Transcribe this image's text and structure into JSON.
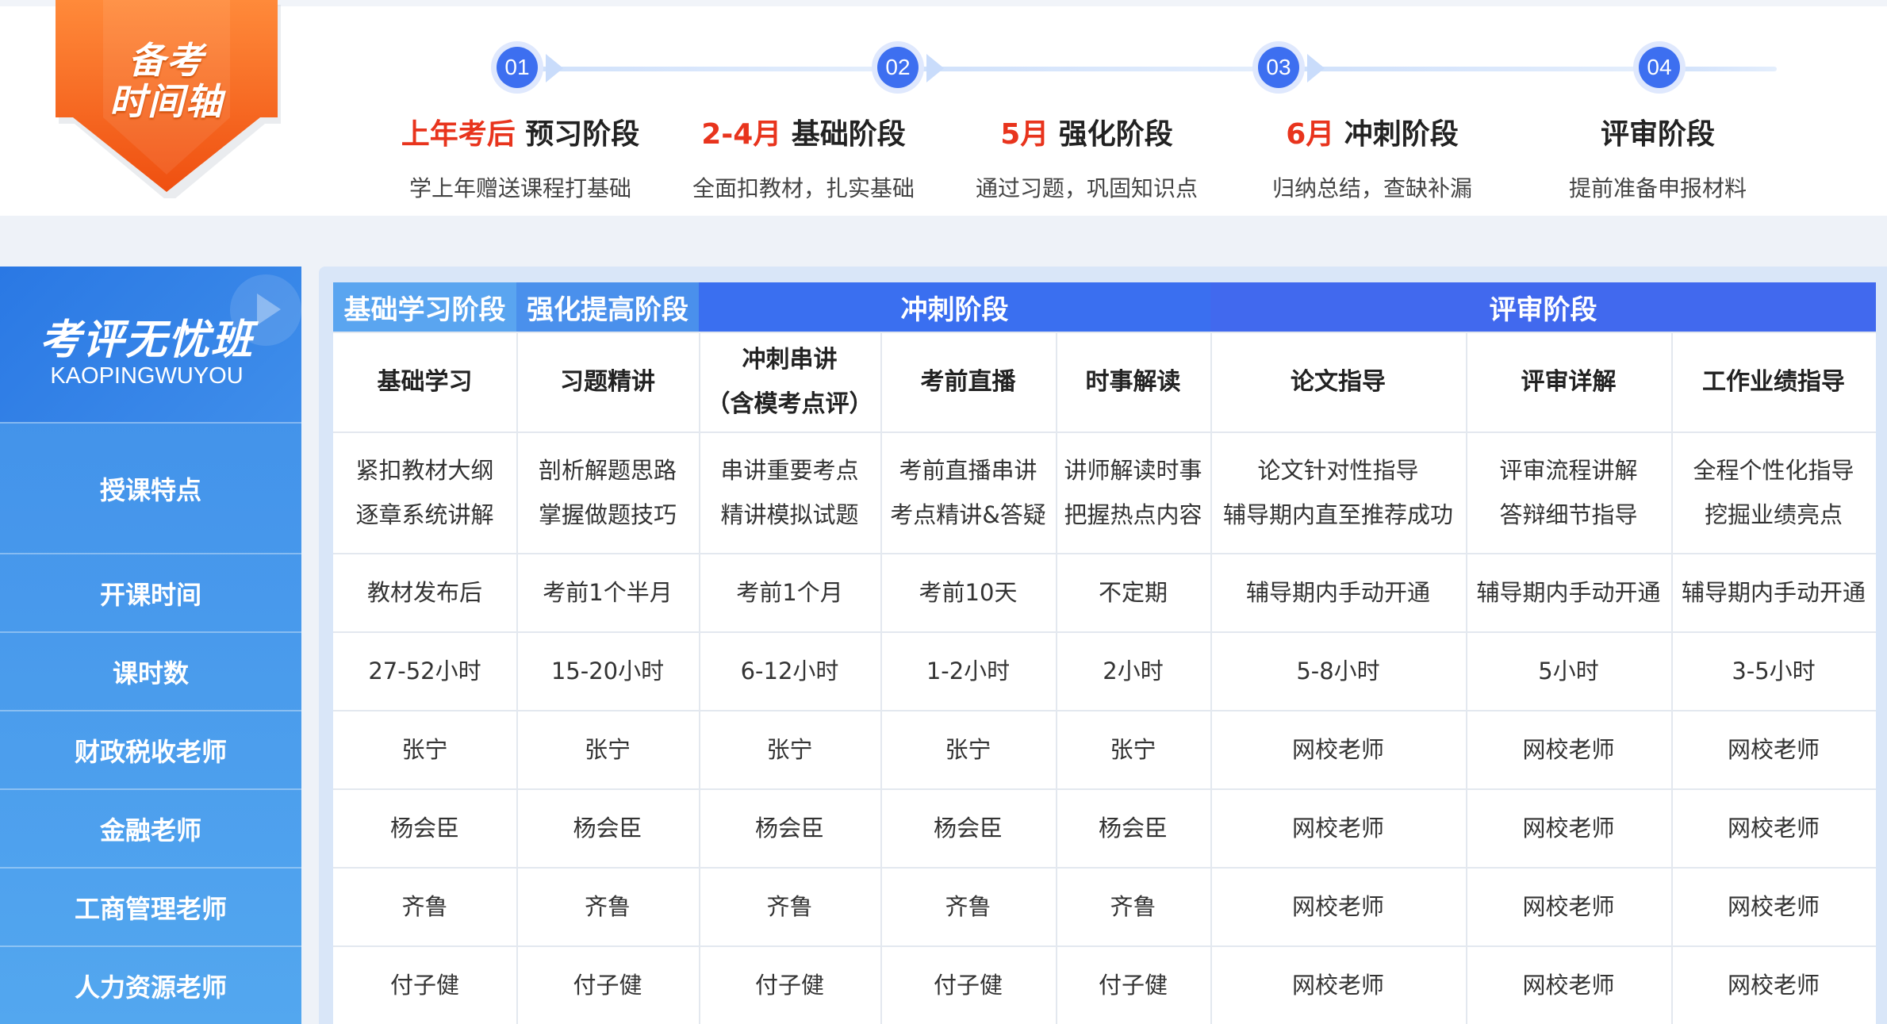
{
  "badge": {
    "line1": "备考",
    "line2": "时间轴"
  },
  "timeline": [
    {
      "num": "01",
      "highlight": "上年考后",
      "title": " 预习阶段",
      "desc": "学上年赠送课程打基础"
    },
    {
      "num": "02",
      "highlight": "2-4月",
      "title": " 基础阶段",
      "desc": "全面扣教材，扎实基础"
    },
    {
      "num": "03",
      "highlight": "5月",
      "title": " 强化阶段",
      "desc": "通过习题，巩固知识点"
    },
    {
      "num": "04",
      "highlight": "6月",
      "title": " 冲刺阶段",
      "desc": "归纳总结，查缺补漏"
    },
    {
      "num": "",
      "highlight": "",
      "title": "评审阶段",
      "desc": "提前准备申报材料"
    }
  ],
  "node_numbers": [
    "01",
    "02",
    "03",
    "04"
  ],
  "logo": {
    "name": "考评无忧班",
    "sub": "KAOPINGWUYOU"
  },
  "row_labels": [
    "授课特点",
    "开课时间",
    "课时数",
    "财政税收老师",
    "金融老师",
    "工商管理老师",
    "人力资源老师"
  ],
  "colors": {
    "phase1": "#5aa5f0",
    "phase2": "#4a90ec",
    "phase3": "#3a6ff0",
    "phase4": "#4169ee",
    "accent": "#e8341d",
    "badge": "#f3641a"
  },
  "phases": [
    "基础学习阶段",
    "强化提高阶段",
    "冲刺阶段",
    "评审阶段"
  ],
  "columns": [
    {
      "h1": "基础学习",
      "h2": ""
    },
    {
      "h1": "习题精讲",
      "h2": ""
    },
    {
      "h1": "冲刺串讲",
      "h2": "（含模考点评）"
    },
    {
      "h1": "考前直播",
      "h2": ""
    },
    {
      "h1": "时事解读",
      "h2": ""
    },
    {
      "h1": "论文指导",
      "h2": ""
    },
    {
      "h1": "评审详解",
      "h2": ""
    },
    {
      "h1": "工作业绩指导",
      "h2": ""
    }
  ],
  "features": [
    [
      "紧扣教材大纲",
      "逐章系统讲解"
    ],
    [
      "剖析解题思路",
      "掌握做题技巧"
    ],
    [
      "串讲重要考点",
      "精讲模拟试题"
    ],
    [
      "考前直播串讲",
      "考点精讲&答疑"
    ],
    [
      "讲师解读时事",
      "把握热点内容"
    ],
    [
      "论文针对性指导",
      "辅导期内直至推荐成功"
    ],
    [
      "评审流程讲解",
      "答辩细节指导"
    ],
    [
      "全程个性化指导",
      "挖掘业绩亮点"
    ]
  ],
  "start_times": [
    "教材发布后",
    "考前1个半月",
    "考前1个月",
    "考前10天",
    "不定期",
    "辅导期内手动开通",
    "辅导期内手动开通",
    "辅导期内手动开通"
  ],
  "hours": [
    "27-52小时",
    "15-20小时",
    "6-12小时",
    "1-2小时",
    "2小时",
    "5-8小时",
    "5小时",
    "3-5小时"
  ],
  "teachers": [
    [
      "张宁",
      "张宁",
      "张宁",
      "张宁",
      "张宁",
      "网校老师",
      "网校老师",
      "网校老师"
    ],
    [
      "杨会臣",
      "杨会臣",
      "杨会臣",
      "杨会臣",
      "杨会臣",
      "网校老师",
      "网校老师",
      "网校老师"
    ],
    [
      "齐鲁",
      "齐鲁",
      "齐鲁",
      "齐鲁",
      "齐鲁",
      "网校老师",
      "网校老师",
      "网校老师"
    ],
    [
      "付子健",
      "付子健",
      "付子健",
      "付子健",
      "付子健",
      "网校老师",
      "网校老师",
      "网校老师"
    ]
  ]
}
